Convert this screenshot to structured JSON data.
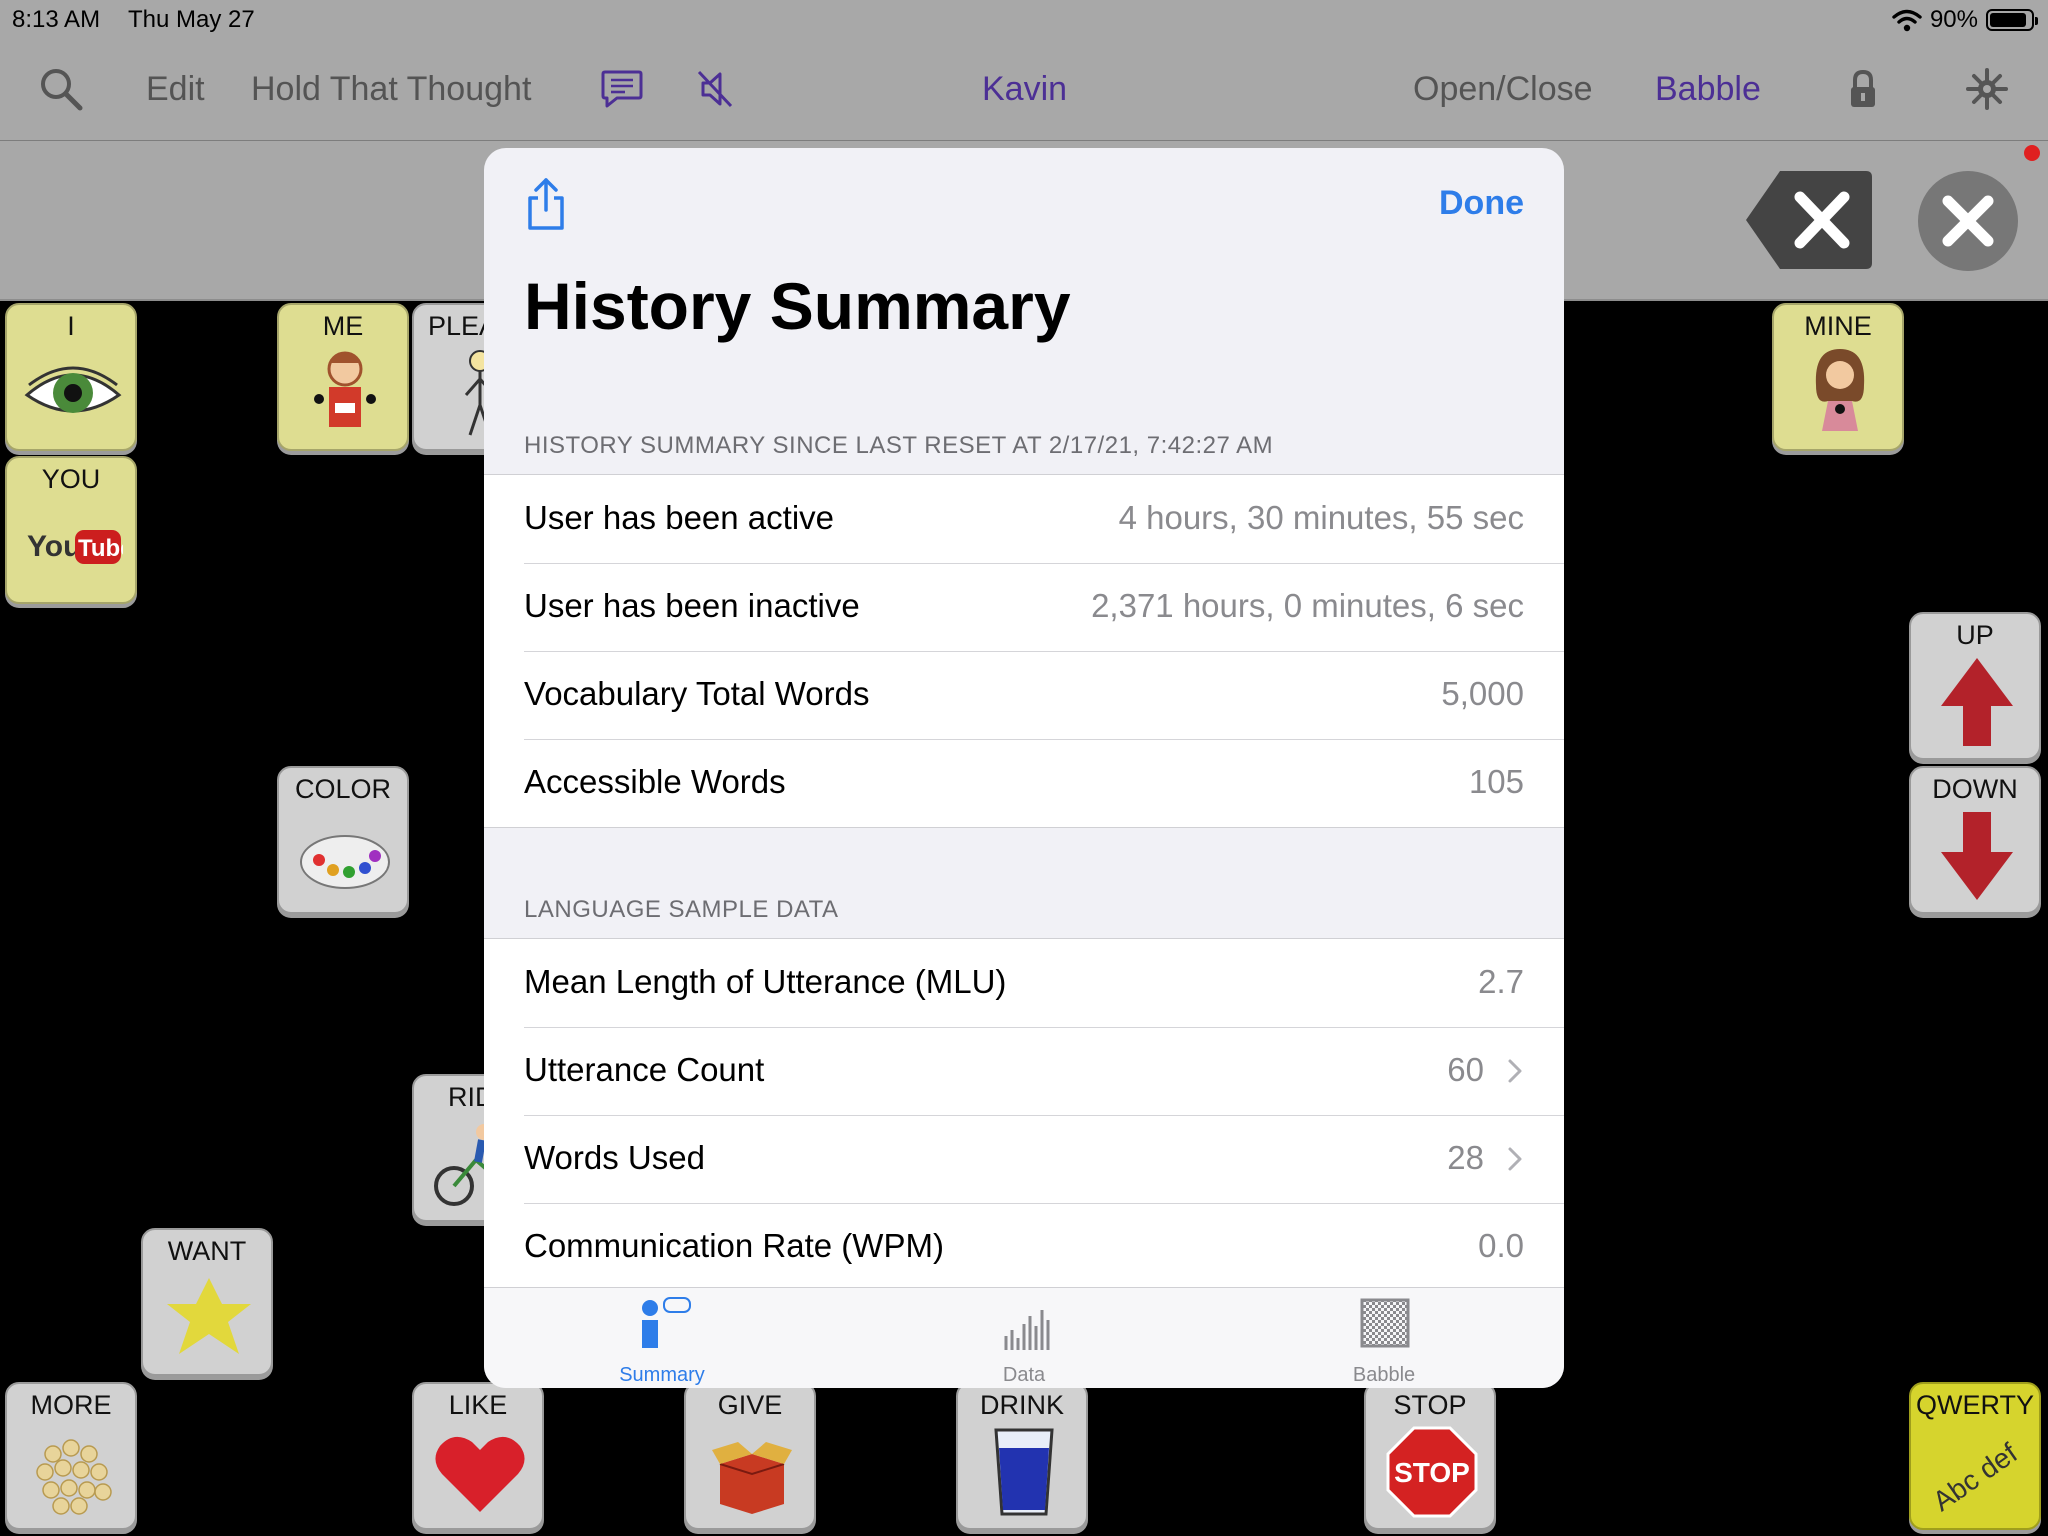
{
  "status_bar": {
    "time": "8:13 AM",
    "date": "Thu May 27",
    "battery": "90%",
    "battery_level": 0.9
  },
  "toolbar": {
    "edit": "Edit",
    "hold_that_thought": "Hold That Thought",
    "user": "Kavin",
    "open_close": "Open/Close",
    "babble": "Babble"
  },
  "grid": {
    "i": "I",
    "me": "ME",
    "please": "PLEA",
    "mine": "MINE",
    "you": "YOU",
    "up": "UP",
    "color": "COLOR",
    "down": "DOWN",
    "ride": "RID",
    "want": "WANT",
    "more": "MORE",
    "like": "LIKE",
    "give": "GIVE",
    "drink": "DRINK",
    "stop": "STOP",
    "qwerty": "QWERTY",
    "stop_sign_text": "STOP",
    "qwerty_sub": "Abc def"
  },
  "modal": {
    "done": "Done",
    "title": "History Summary",
    "section1_header": "HISTORY SUMMARY SINCE LAST RESET AT 2/17/21, 7:42:27 AM",
    "summary_rows": [
      {
        "label": "User has been active",
        "value": "4 hours, 30 minutes, 55 sec"
      },
      {
        "label": "User has been inactive",
        "value": "2,371 hours, 0 minutes, 6 sec"
      },
      {
        "label": "Vocabulary Total Words",
        "value": "5,000"
      },
      {
        "label": "Accessible Words",
        "value": "105"
      }
    ],
    "section2_header": "LANGUAGE SAMPLE DATA",
    "language_rows": [
      {
        "label": "Mean Length of Utterance (MLU)",
        "value": "2.7"
      },
      {
        "label": "Utterance Count",
        "value": "60"
      },
      {
        "label": "Words Used",
        "value": "28"
      },
      {
        "label": "Communication Rate (WPM)",
        "value": "0.0"
      }
    ],
    "tabs": [
      {
        "label": "Summary",
        "active": true
      },
      {
        "label": "Data",
        "active": false
      },
      {
        "label": "Babble",
        "active": false
      }
    ]
  },
  "colors": {
    "accent_blue": "#2e7de9",
    "purple": "#4c2f95",
    "toolbar_gray": "#a8a8a8"
  }
}
